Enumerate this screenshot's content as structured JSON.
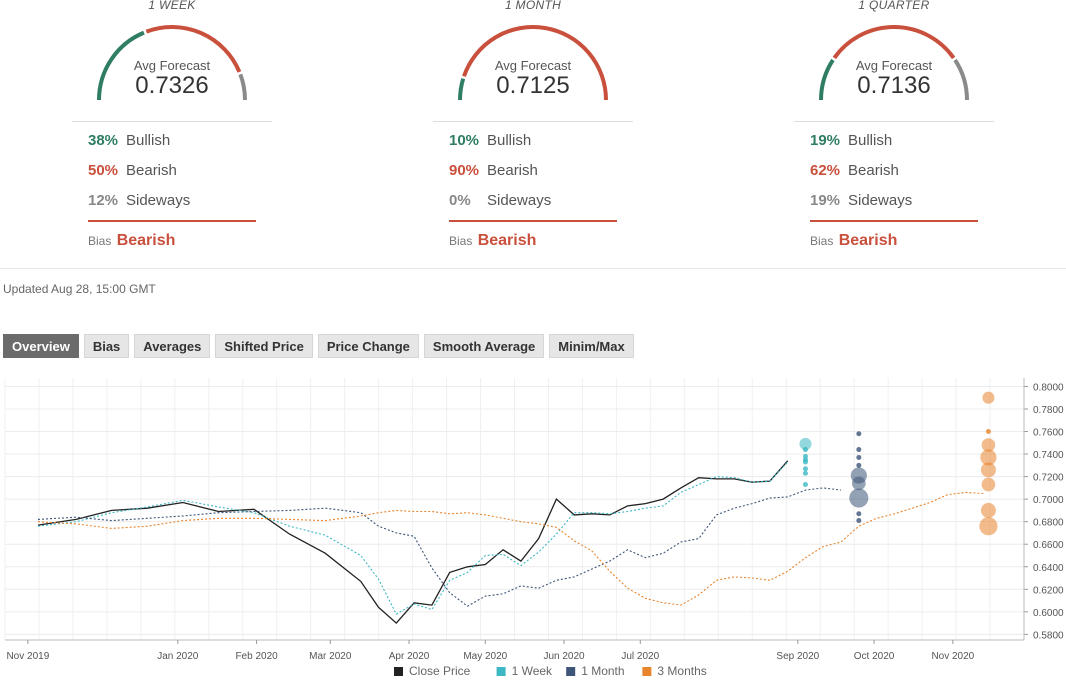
{
  "panels": [
    {
      "period": "1 WEEK",
      "avg_label": "Avg Forecast",
      "avg_value": "0.7326",
      "bullish_pct": "38%",
      "bullish_label": "Bullish",
      "bearish_pct": "50%",
      "bearish_label": "Bearish",
      "sideways_pct": "12%",
      "sideways_label": "Sideways",
      "bias_label": "Bias",
      "bias_value": "Bearish",
      "split": [
        0.38,
        0.5,
        0.12
      ]
    },
    {
      "period": "1 MONTH",
      "avg_label": "Avg Forecast",
      "avg_value": "0.7125",
      "bullish_pct": "10%",
      "bullish_label": "Bullish",
      "bearish_pct": "90%",
      "bearish_label": "Bearish",
      "sideways_pct": "0%",
      "sideways_label": "Sideways",
      "bias_label": "Bias",
      "bias_value": "Bearish",
      "split": [
        0.1,
        0.9,
        0.0
      ]
    },
    {
      "period": "1 QUARTER",
      "avg_label": "Avg Forecast",
      "avg_value": "0.7136",
      "bullish_pct": "19%",
      "bullish_label": "Bullish",
      "bearish_pct": "62%",
      "bearish_label": "Bearish",
      "sideways_pct": "19%",
      "sideways_label": "Sideways",
      "bias_label": "Bias",
      "bias_value": "Bearish",
      "split": [
        0.19,
        0.62,
        0.19
      ]
    }
  ],
  "colors": {
    "bullish": "#2e7d64",
    "bearish": "#c9503c",
    "sideways": "#8a8a8a"
  },
  "updated": "Updated Aug 28, 15:00 GMT",
  "tabs": [
    "Overview",
    "Bias",
    "Averages",
    "Shifted Price",
    "Price Change",
    "Smooth Average",
    "Minim/Max"
  ],
  "chart_data": {
    "type": "line",
    "x_ticks": [
      "Nov 2019",
      "Jan 2020",
      "Feb 2020",
      "Mar 2020",
      "Apr 2020",
      "May 2020",
      "Jun 2020",
      "Jul 2020",
      "Sep 2020",
      "Oct 2020",
      "Nov 2020"
    ],
    "y_ticks": [
      "0.8000",
      "0.7800",
      "0.7600",
      "0.7400",
      "0.7200",
      "0.7000",
      "0.6800",
      "0.6600",
      "0.6400",
      "0.6200",
      "0.6000",
      "0.5800"
    ],
    "ylim": [
      0.575,
      0.8075
    ],
    "legend_position": "bottom",
    "series": [
      {
        "name": "Close Price",
        "color": "#222222",
        "style": "solid",
        "x": [
          "2019-11-07",
          "2019-11-22",
          "2019-12-06",
          "2019-12-20",
          "2020-01-03",
          "2020-01-17",
          "2020-01-31",
          "2020-02-14",
          "2020-02-28",
          "2020-03-13",
          "2020-03-20",
          "2020-03-27",
          "2020-04-03",
          "2020-04-10",
          "2020-04-17",
          "2020-04-24",
          "2020-05-01",
          "2020-05-08",
          "2020-05-15",
          "2020-05-22",
          "2020-05-29",
          "2020-06-05",
          "2020-06-12",
          "2020-06-19",
          "2020-06-26",
          "2020-07-03",
          "2020-07-10",
          "2020-07-17",
          "2020-07-24",
          "2020-07-31",
          "2020-08-07",
          "2020-08-14",
          "2020-08-21",
          "2020-08-28"
        ],
        "y": [
          0.677,
          0.682,
          0.69,
          0.692,
          0.697,
          0.689,
          0.691,
          0.669,
          0.652,
          0.627,
          0.604,
          0.59,
          0.608,
          0.606,
          0.635,
          0.64,
          0.642,
          0.655,
          0.645,
          0.665,
          0.7,
          0.686,
          0.687,
          0.686,
          0.694,
          0.696,
          0.7,
          0.71,
          0.719,
          0.718,
          0.718,
          0.715,
          0.716,
          0.734
        ]
      },
      {
        "name": "1 Week",
        "color": "#3bb8c4",
        "style": "dashed",
        "x": [
          "2019-11-07",
          "2019-11-22",
          "2019-12-06",
          "2019-12-20",
          "2020-01-03",
          "2020-01-17",
          "2020-01-31",
          "2020-02-14",
          "2020-02-28",
          "2020-03-13",
          "2020-03-20",
          "2020-03-27",
          "2020-04-03",
          "2020-04-10",
          "2020-04-17",
          "2020-04-24",
          "2020-05-01",
          "2020-05-08",
          "2020-05-15",
          "2020-05-22",
          "2020-05-29",
          "2020-06-05",
          "2020-06-12",
          "2020-06-19",
          "2020-06-26",
          "2020-07-03",
          "2020-07-10",
          "2020-07-17",
          "2020-07-24",
          "2020-07-31",
          "2020-08-07",
          "2020-08-14",
          "2020-08-21",
          "2020-08-28"
        ],
        "y": [
          0.676,
          0.68,
          0.688,
          0.693,
          0.699,
          0.693,
          0.688,
          0.676,
          0.668,
          0.65,
          0.629,
          0.598,
          0.607,
          0.602,
          0.628,
          0.635,
          0.65,
          0.651,
          0.641,
          0.653,
          0.669,
          0.688,
          0.688,
          0.687,
          0.689,
          0.692,
          0.694,
          0.706,
          0.713,
          0.72,
          0.719,
          0.715,
          0.716,
          0.733
        ]
      },
      {
        "name": "1 Month",
        "color": "#3c5578",
        "style": "dashed",
        "x": [
          "2019-11-07",
          "2019-11-22",
          "2019-12-06",
          "2019-12-20",
          "2020-01-03",
          "2020-01-17",
          "2020-01-31",
          "2020-02-14",
          "2020-02-28",
          "2020-03-13",
          "2020-03-20",
          "2020-03-27",
          "2020-04-03",
          "2020-04-10",
          "2020-04-17",
          "2020-04-24",
          "2020-05-01",
          "2020-05-08",
          "2020-05-15",
          "2020-05-22",
          "2020-05-29",
          "2020-06-05",
          "2020-06-12",
          "2020-06-19",
          "2020-06-26",
          "2020-07-03",
          "2020-07-10",
          "2020-07-17",
          "2020-07-24",
          "2020-07-31",
          "2020-08-07",
          "2020-08-14",
          "2020-08-21",
          "2020-08-28",
          "2020-09-04",
          "2020-09-11",
          "2020-09-18"
        ],
        "y": [
          0.682,
          0.684,
          0.681,
          0.683,
          0.685,
          0.688,
          0.689,
          0.69,
          0.692,
          0.688,
          0.676,
          0.67,
          0.667,
          0.639,
          0.617,
          0.605,
          0.614,
          0.616,
          0.623,
          0.621,
          0.628,
          0.631,
          0.638,
          0.645,
          0.655,
          0.648,
          0.652,
          0.662,
          0.665,
          0.686,
          0.692,
          0.696,
          0.701,
          0.702,
          0.708,
          0.71,
          0.708
        ]
      },
      {
        "name": "3 Months",
        "color": "#e8842c",
        "style": "dashed",
        "x": [
          "2019-11-07",
          "2019-11-22",
          "2019-12-06",
          "2019-12-20",
          "2020-01-03",
          "2020-01-17",
          "2020-01-31",
          "2020-02-14",
          "2020-02-28",
          "2020-03-13",
          "2020-03-20",
          "2020-03-27",
          "2020-04-03",
          "2020-04-10",
          "2020-04-17",
          "2020-04-24",
          "2020-05-01",
          "2020-05-08",
          "2020-05-15",
          "2020-05-22",
          "2020-05-29",
          "2020-06-05",
          "2020-06-12",
          "2020-06-19",
          "2020-06-26",
          "2020-07-03",
          "2020-07-10",
          "2020-07-17",
          "2020-07-24",
          "2020-07-31",
          "2020-08-07",
          "2020-08-14",
          "2020-08-21",
          "2020-08-28",
          "2020-09-04",
          "2020-09-11",
          "2020-09-18",
          "2020-09-25",
          "2020-10-02",
          "2020-10-09",
          "2020-10-16",
          "2020-10-23",
          "2020-10-30",
          "2020-11-06",
          "2020-11-13"
        ],
        "y": [
          0.68,
          0.678,
          0.674,
          0.676,
          0.681,
          0.683,
          0.683,
          0.682,
          0.681,
          0.685,
          0.688,
          0.69,
          0.689,
          0.689,
          0.687,
          0.688,
          0.686,
          0.683,
          0.68,
          0.678,
          0.675,
          0.663,
          0.654,
          0.636,
          0.621,
          0.612,
          0.608,
          0.606,
          0.615,
          0.628,
          0.631,
          0.63,
          0.628,
          0.636,
          0.648,
          0.658,
          0.662,
          0.676,
          0.683,
          0.687,
          0.692,
          0.697,
          0.704,
          0.706,
          0.705
        ]
      }
    ],
    "forecast_bubbles": [
      {
        "series": "1 Week",
        "x": "2020-09-04",
        "points": [
          {
            "y": 0.749,
            "weight": 2
          },
          {
            "y": 0.735,
            "weight": 1
          },
          {
            "y": 0.738,
            "weight": 1
          },
          {
            "y": 0.733,
            "weight": 1
          },
          {
            "y": 0.727,
            "weight": 1
          },
          {
            "y": 0.723,
            "weight": 1
          },
          {
            "y": 0.713,
            "weight": 1
          },
          {
            "y": 0.744,
            "weight": 1
          }
        ]
      },
      {
        "series": "1 Month",
        "x": "2020-09-25",
        "points": [
          {
            "y": 0.701,
            "weight": 8
          },
          {
            "y": 0.721,
            "weight": 5
          },
          {
            "y": 0.714,
            "weight": 3
          },
          {
            "y": 0.758,
            "weight": 1
          },
          {
            "y": 0.744,
            "weight": 1
          },
          {
            "y": 0.737,
            "weight": 1
          },
          {
            "y": 0.73,
            "weight": 1
          },
          {
            "y": 0.687,
            "weight": 1
          },
          {
            "y": 0.681,
            "weight": 1
          }
        ]
      },
      {
        "series": "3 Months",
        "x": "2020-11-15",
        "points": [
          {
            "y": 0.79,
            "weight": 2
          },
          {
            "y": 0.76,
            "weight": 1
          },
          {
            "y": 0.748,
            "weight": 3
          },
          {
            "y": 0.737,
            "weight": 5
          },
          {
            "y": 0.726,
            "weight": 4
          },
          {
            "y": 0.713,
            "weight": 3
          },
          {
            "y": 0.69,
            "weight": 4
          },
          {
            "y": 0.676,
            "weight": 7
          }
        ]
      }
    ]
  }
}
